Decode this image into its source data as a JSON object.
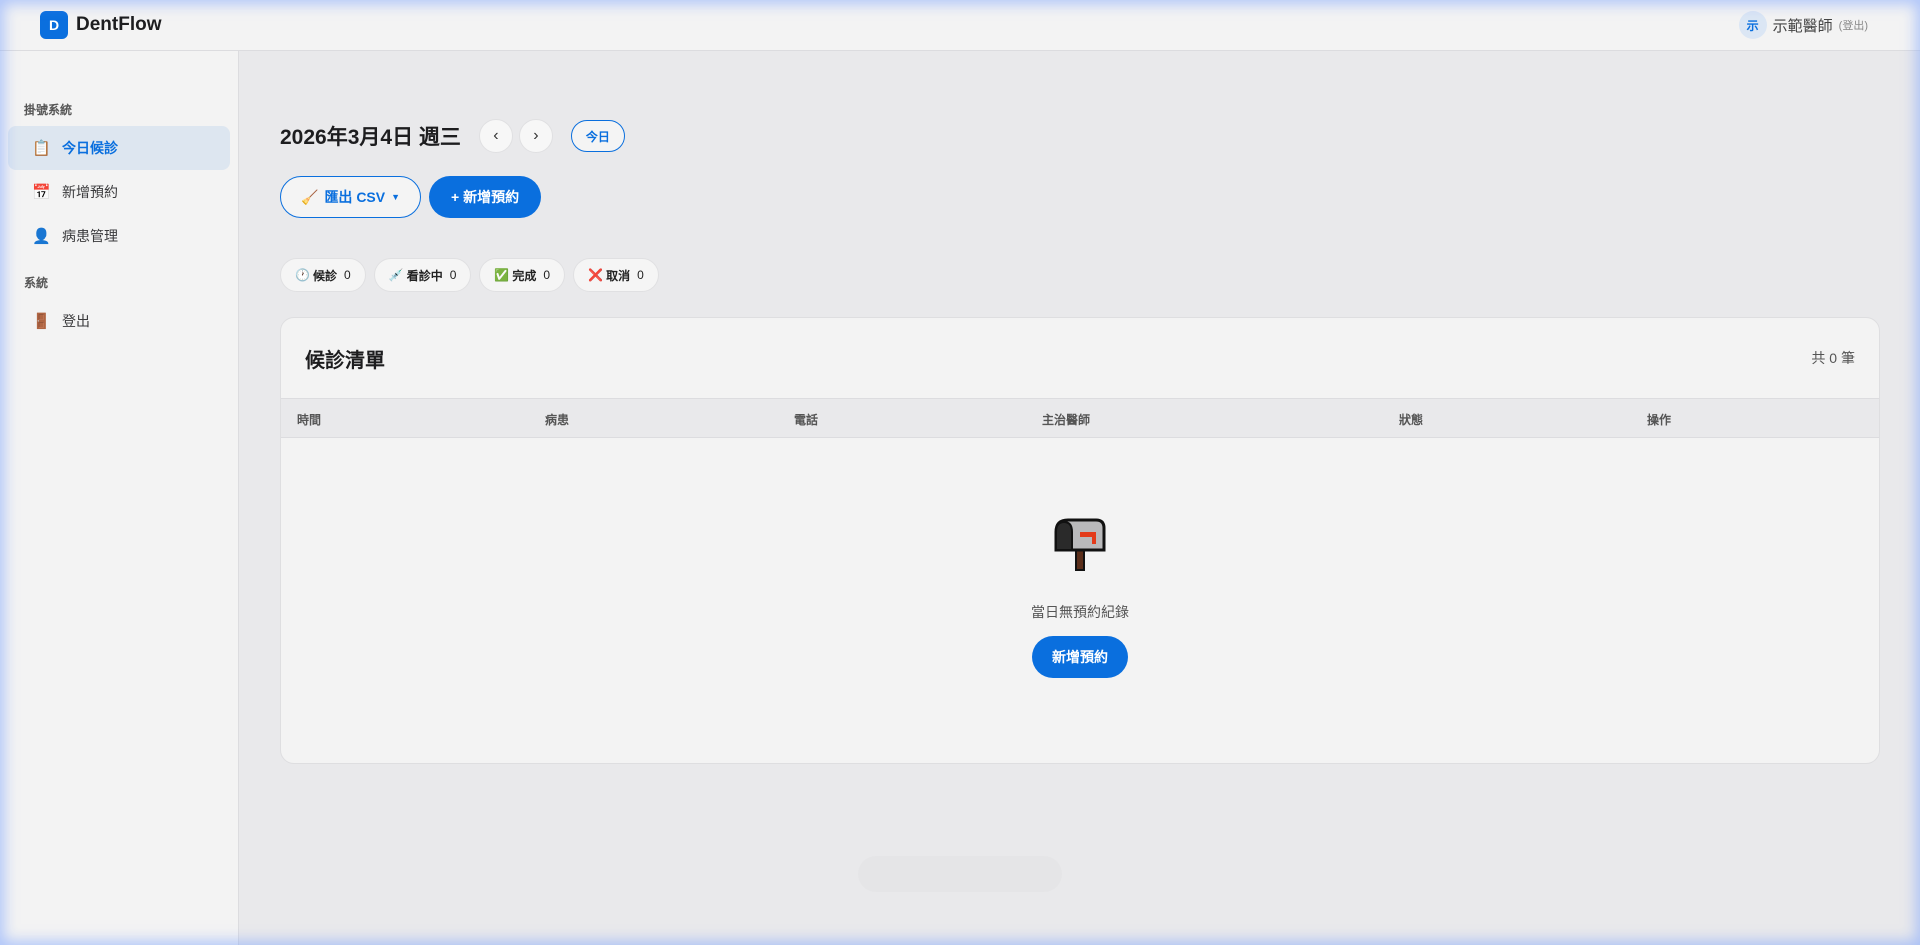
{
  "header": {
    "logo_letter": "D",
    "app_name": "DentFlow",
    "user_avatar": "示",
    "user_name": "示範醫師",
    "logout_hint": "(登出)"
  },
  "sidebar": {
    "section1": "掛號系統",
    "items": [
      {
        "label": "今日候診",
        "icon": "clipboard-icon",
        "glyph": "📋",
        "active": true
      },
      {
        "label": "新增預約",
        "icon": "calendar-icon",
        "glyph": "📅",
        "active": false
      },
      {
        "label": "病患管理",
        "icon": "person-icon",
        "glyph": "👤",
        "active": false
      }
    ],
    "section2": "系統",
    "logout": {
      "label": "登出",
      "icon": "door-icon",
      "glyph": "🚪"
    }
  },
  "main": {
    "date_title": "2026年3月4日 週三",
    "prev_label": "‹",
    "next_label": "›",
    "today_label": "今日",
    "export_label": "匯出 CSV",
    "export_icon": "🧹",
    "add_label": "+ 新增預約",
    "stats": [
      {
        "icon": "clock-icon",
        "glyph": "🕐",
        "label": "候診",
        "count": "0"
      },
      {
        "icon": "syringe-icon",
        "glyph": "💉",
        "label": "看診中",
        "count": "0"
      },
      {
        "icon": "check-icon",
        "glyph": "✅",
        "label": "完成",
        "count": "0"
      },
      {
        "icon": "cross-icon",
        "glyph": "❌",
        "label": "取消",
        "count": "0"
      }
    ],
    "card": {
      "title": "候診清單",
      "count": "共 0 筆",
      "columns": [
        "時間",
        "病患",
        "電話",
        "主治醫師",
        "狀態",
        "操作"
      ],
      "empty_text": "當日無預約紀錄",
      "empty_button": "新增預約"
    }
  },
  "colors": {
    "accent": "#0a6fde",
    "background": "#e9e9eb",
    "surface": "#f3f3f3"
  }
}
